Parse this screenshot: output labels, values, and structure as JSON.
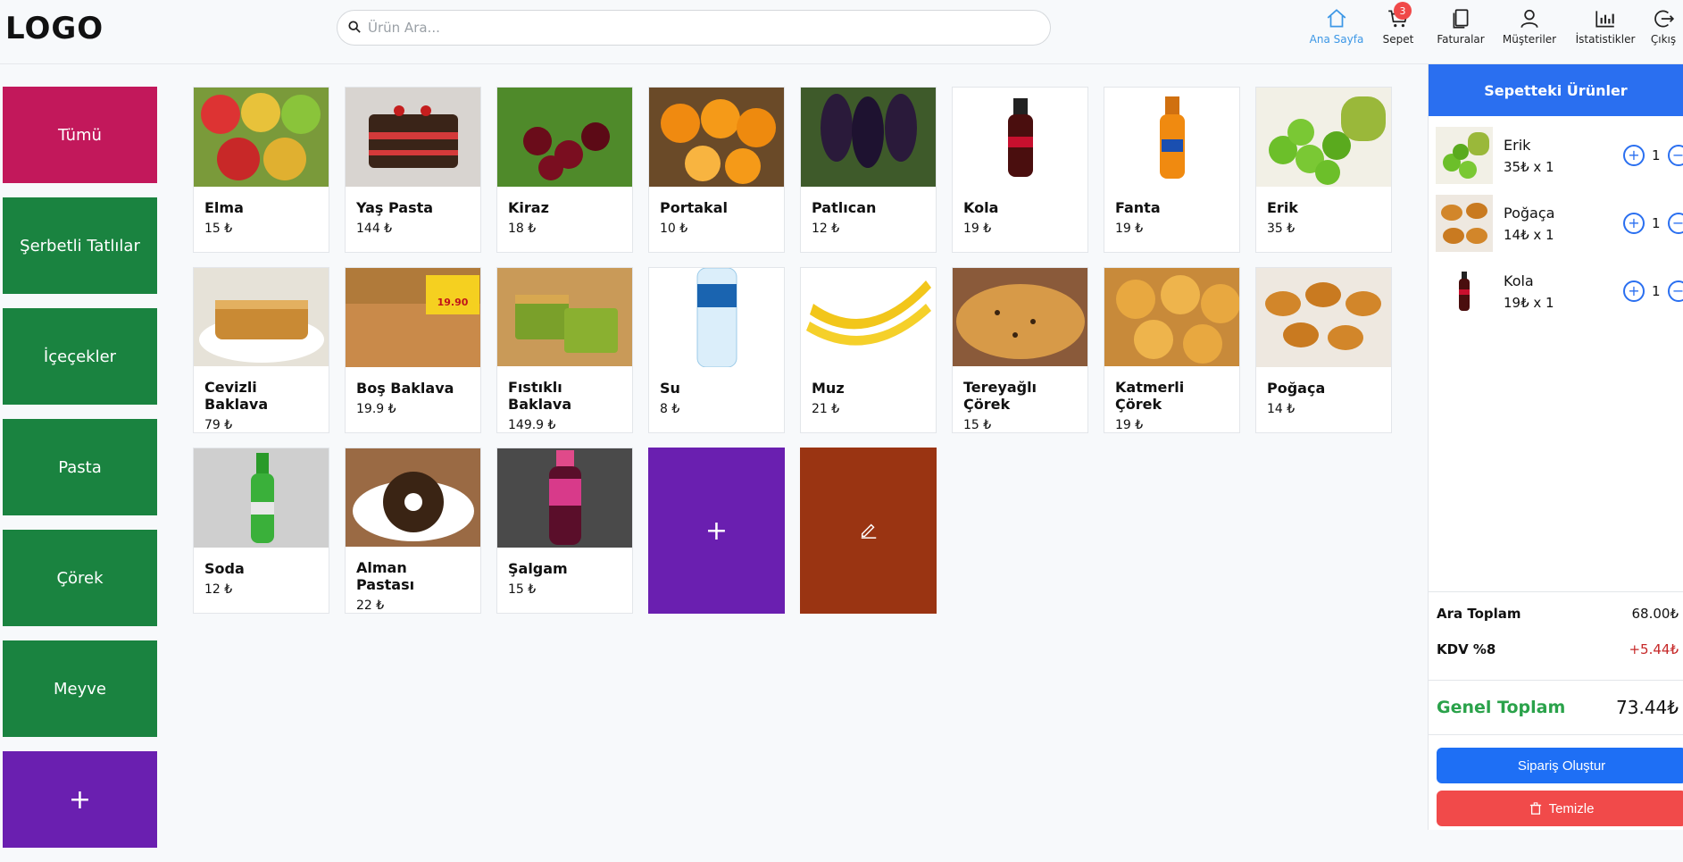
{
  "header": {
    "logo": "LOGO",
    "search_placeholder": "Ürün Ara...",
    "nav": [
      {
        "label": "Ana Sayfa",
        "icon": "home-icon",
        "active": true
      },
      {
        "label": "Sepet",
        "icon": "cart-icon",
        "badge": "3"
      },
      {
        "label": "Faturalar",
        "icon": "invoice-icon"
      },
      {
        "label": "Müşteriler",
        "icon": "user-icon"
      },
      {
        "label": "İstatistikler",
        "icon": "chart-icon"
      },
      {
        "label": "Çıkış",
        "icon": "logout-icon"
      }
    ]
  },
  "categories": [
    "Tümü",
    "Şerbetli Tatlılar",
    "İçeçekler",
    "Pasta",
    "Çörek",
    "Meyve"
  ],
  "category_add": "+",
  "products": [
    {
      "name": "Elma",
      "price": "15 ₺"
    },
    {
      "name": "Yaş Pasta",
      "price": "144 ₺"
    },
    {
      "name": "Kiraz",
      "price": "18 ₺"
    },
    {
      "name": "Portakal",
      "price": "10 ₺"
    },
    {
      "name": "Patlıcan",
      "price": "12 ₺"
    },
    {
      "name": "Kola",
      "price": "19 ₺"
    },
    {
      "name": "Fanta",
      "price": "19 ₺"
    },
    {
      "name": "Erik",
      "price": "35 ₺"
    },
    {
      "name": "Cevizli Baklava",
      "price": "79 ₺"
    },
    {
      "name": "Boş Baklava",
      "price": "19.9 ₺"
    },
    {
      "name": "Fıstıklı Baklava",
      "price": "149.9 ₺"
    },
    {
      "name": "Su",
      "price": "8 ₺"
    },
    {
      "name": "Muz",
      "price": "21 ₺"
    },
    {
      "name": "Tereyağlı Çörek",
      "price": "15 ₺"
    },
    {
      "name": "Katmerli Çörek",
      "price": "19 ₺"
    },
    {
      "name": "Poğaça",
      "price": "14 ₺"
    },
    {
      "name": "Soda",
      "price": "12 ₺"
    },
    {
      "name": "Alman Pastası",
      "price": "22 ₺"
    },
    {
      "name": "Şalgam",
      "price": "15 ₺"
    }
  ],
  "tiles": {
    "add": "+",
    "edit": "✎"
  },
  "cart": {
    "title": "Sepetteki Ürünler",
    "items": [
      {
        "name": "Erik",
        "sub": "35₺ x 1",
        "qty": "1"
      },
      {
        "name": "Poğaça",
        "sub": "14₺ x 1",
        "qty": "1"
      },
      {
        "name": "Kola",
        "sub": "19₺ x 1",
        "qty": "1"
      }
    ],
    "subtotal_label": "Ara Toplam",
    "subtotal": "68.00₺",
    "kdv_label": "KDV %8",
    "kdv": "+5.44₺",
    "grand_label": "Genel Toplam",
    "grand": "73.44₺",
    "order_button": "Sipariş Oluştur",
    "clear_button": "Temizle"
  }
}
